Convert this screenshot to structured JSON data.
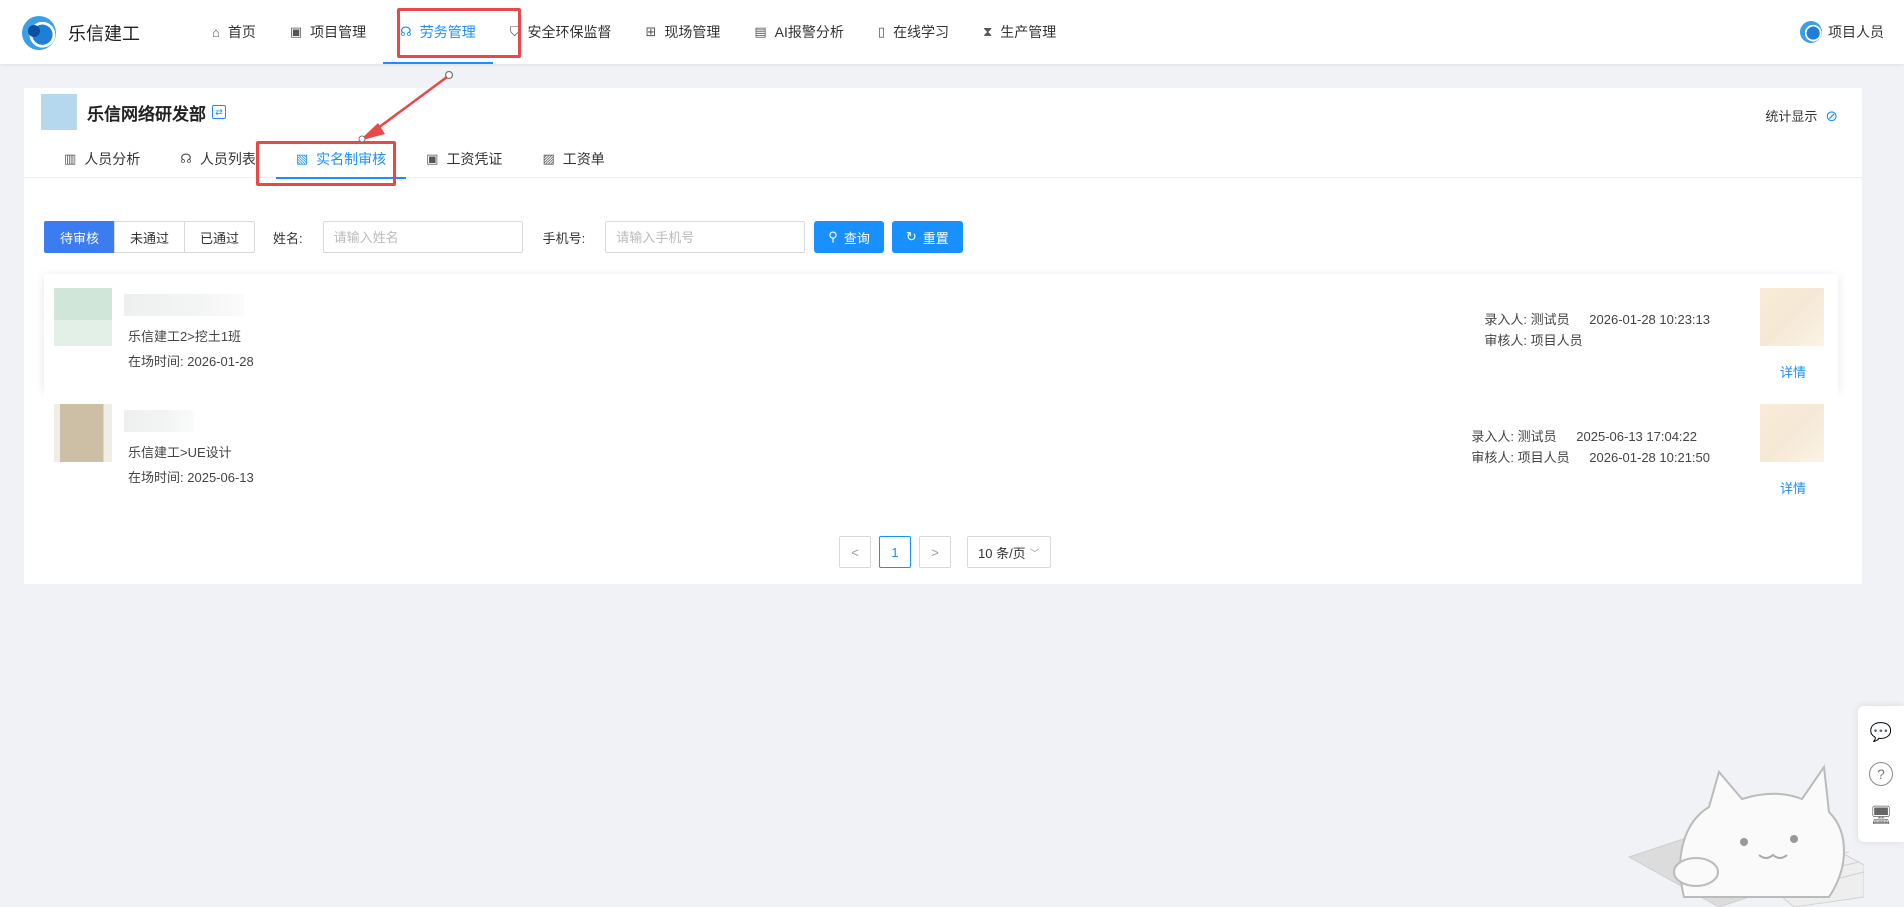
{
  "app": {
    "brand": "乐信建工",
    "user": "项目人员"
  },
  "nav": {
    "items": [
      {
        "label": "首页",
        "icon": "home-icon"
      },
      {
        "label": "项目管理",
        "icon": "project-icon"
      },
      {
        "label": "劳务管理",
        "icon": "labor-icon",
        "active": true
      },
      {
        "label": "安全环保监督",
        "icon": "shield-icon"
      },
      {
        "label": "现场管理",
        "icon": "site-icon"
      },
      {
        "label": "AI报警分析",
        "icon": "ai-alarm-icon"
      },
      {
        "label": "在线学习",
        "icon": "book-icon"
      },
      {
        "label": "生产管理",
        "icon": "hourglass-icon"
      }
    ]
  },
  "dept": {
    "name": "乐信网络研发部",
    "stat_toggle": "统计显示"
  },
  "subtabs": [
    {
      "label": "人员分析",
      "icon": "bar-chart-icon"
    },
    {
      "label": "人员列表",
      "icon": "people-icon"
    },
    {
      "label": "实名制审核",
      "icon": "audit-icon",
      "active": true
    },
    {
      "label": "工资凭证",
      "icon": "voucher-icon"
    },
    {
      "label": "工资单",
      "icon": "payslip-icon"
    }
  ],
  "filter": {
    "statuses": [
      "待审核",
      "未通过",
      "已通过"
    ],
    "name_label": "姓名:",
    "name_placeholder": "请输入姓名",
    "phone_label": "手机号:",
    "phone_placeholder": "请输入手机号",
    "search_label": "查询",
    "reset_label": "重置"
  },
  "records": [
    {
      "team": "乐信建工2>挖土1班",
      "onsite_label": "在场时间:",
      "onsite_date": "2026-01-28",
      "entered_by_label": "录入人:",
      "entered_by": "测试员",
      "entered_at": "2026-01-28 10:23:13",
      "reviewer_label": "审核人:",
      "reviewer": "项目人员",
      "reviewed_at": "",
      "detail_label": "详情"
    },
    {
      "team": "乐信建工>UE设计",
      "onsite_label": "在场时间:",
      "onsite_date": "2025-06-13",
      "entered_by_label": "录入人:",
      "entered_by": "测试员",
      "entered_at": "2025-06-13 17:04:22",
      "reviewer_label": "审核人:",
      "reviewer": "项目人员",
      "reviewed_at": "2026-01-28 10:21:50",
      "detail_label": "详情"
    }
  ],
  "pagination": {
    "prev": "<",
    "current": "1",
    "next": ">",
    "page_size": "10 条/页"
  },
  "colors": {
    "primary": "#1890ff",
    "highlight": "#e94848",
    "page_bg": "#f0f2f5"
  }
}
